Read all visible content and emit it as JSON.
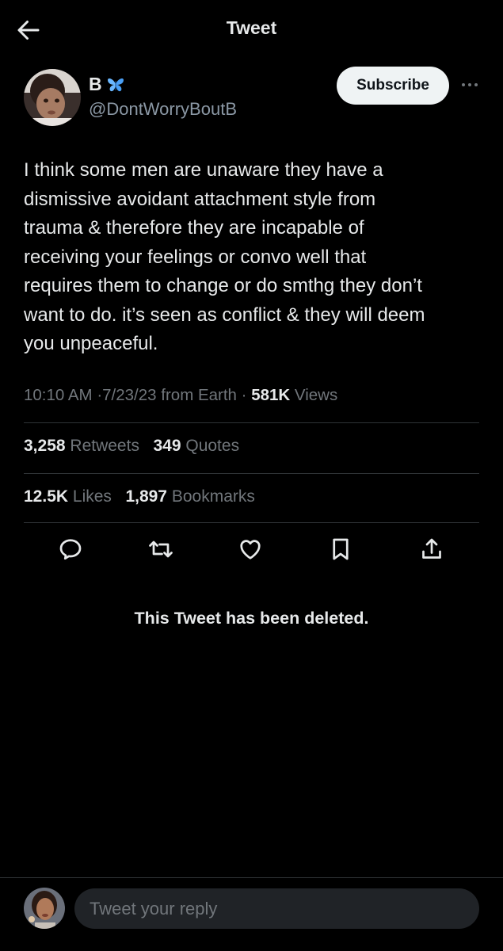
{
  "header": {
    "title": "Tweet",
    "back_icon": "arrow-left-icon"
  },
  "author": {
    "name": "B",
    "badge_icon": "butterfly-icon",
    "badge_color": "#6ab7ff",
    "handle": "@DontWorryBoutB",
    "subscribe_label": "Subscribe",
    "more_icon": "ellipsis-icon"
  },
  "tweet": {
    "lines": [
      "I think some men are unaware they have a",
      "dismissive avoidant attachment style from",
      "trauma & therefore they are incapable of",
      "receiving your feelings or convo well that",
      "requires them to change or do smthg they don’t",
      "want to do. it’s seen as conflict & they will deem",
      "you unpeaceful."
    ],
    "time": "10:10 AM",
    "date": "7/23/23",
    "source": "from Earth",
    "views_count": "581K",
    "views_label": "Views",
    "separator": "·"
  },
  "stats": {
    "retweets_count": "3,258",
    "retweets_label": "Retweets",
    "quotes_count": "349",
    "quotes_label": "Quotes",
    "likes_count": "12.5K",
    "likes_label": "Likes",
    "bookmarks_count": "1,897",
    "bookmarks_label": "Bookmarks"
  },
  "actions": [
    {
      "icon": "reply-icon"
    },
    {
      "icon": "retweet-icon"
    },
    {
      "icon": "like-icon"
    },
    {
      "icon": "bookmark-icon"
    },
    {
      "icon": "share-icon"
    }
  ],
  "deleted_notice": "This Tweet has been deleted.",
  "reply": {
    "placeholder": "Tweet your reply"
  },
  "colors": {
    "background": "#000000",
    "text_primary": "#e7e9ea",
    "text_secondary": "#71767b",
    "divider": "#2f3336",
    "subscribe_bg": "#eff3f4",
    "reply_field_bg": "#202327"
  }
}
